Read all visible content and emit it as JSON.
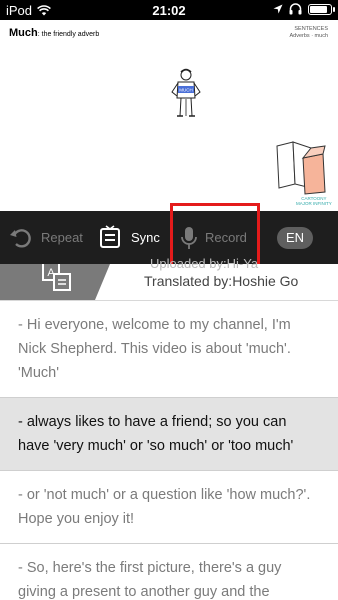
{
  "statusbar": {
    "carrier": "iPod",
    "time": "21:02"
  },
  "video": {
    "title_word": "Much",
    "title_rest": ": the friendly adverb",
    "top_right_line1": "SENTENCES",
    "top_right_line2": "Adverbs · much",
    "man_shirt_label": "MUCH",
    "caption_line1": "CARTOONY",
    "caption_line2": "MAJOR INFINITY"
  },
  "toolbar": {
    "repeat_label": "Repeat",
    "sync_label": "Sync",
    "record_label": "Record",
    "language_label": "EN"
  },
  "info": {
    "uploaded_line": "Uploaded by:Hi-Ya",
    "translated_line": "Translated by:Hoshie Go"
  },
  "transcript": [
    {
      "text": "- Hi everyone, welcome to my channel, I'm Nick Shepherd. This video is about 'much'. 'Much'",
      "active": false
    },
    {
      "text": "- always likes to have a friend; so you can have 'very much' or 'so much' or 'too much'",
      "active": true
    },
    {
      "text": "- or 'not much' or a question like 'how much?'. Hope you enjoy it!",
      "active": false
    },
    {
      "text": "- So, here's the first picture, there's a guy giving a present to another guy and the",
      "active": false
    }
  ],
  "colors": {
    "toolbar_bg": "#1e1e1e",
    "highlight": "#e41b1b",
    "active_row": "#e3e3e3"
  }
}
